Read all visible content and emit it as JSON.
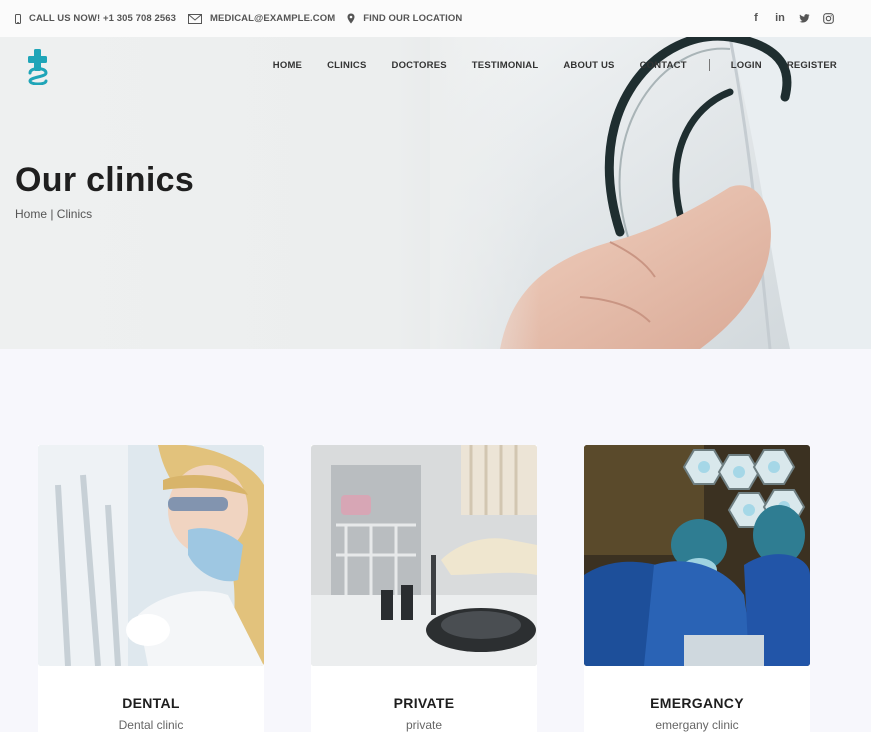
{
  "topbar": {
    "phone": "CALL US NOW! +1 305 708 2563",
    "email": "MEDICAL@EXAMPLE.COM",
    "location": "FIND OUR LOCATION",
    "social_icons": [
      "facebook-icon",
      "linkedin-icon",
      "twitter-icon",
      "instagram-icon"
    ]
  },
  "nav": {
    "home": "HOME",
    "clinics": "CLINICS",
    "doctors": "DOCTORES",
    "testimonial": "TESTIMONIAL",
    "about": "ABOUT US",
    "contact": "CONTACT",
    "login": "LOGIN",
    "register": "REGISTER"
  },
  "hero": {
    "title": "Our clinics",
    "breadcrumb": "Home | Clinics"
  },
  "clinics": [
    {
      "title": "DENTAL",
      "subtitle": "Dental clinic"
    },
    {
      "title": "PRIVATE",
      "subtitle": "private"
    },
    {
      "title": "EMERGANCY",
      "subtitle": "emergany clinic"
    }
  ],
  "colors": {
    "accent": "#1fa5b8",
    "background": "#f7f7fc"
  }
}
